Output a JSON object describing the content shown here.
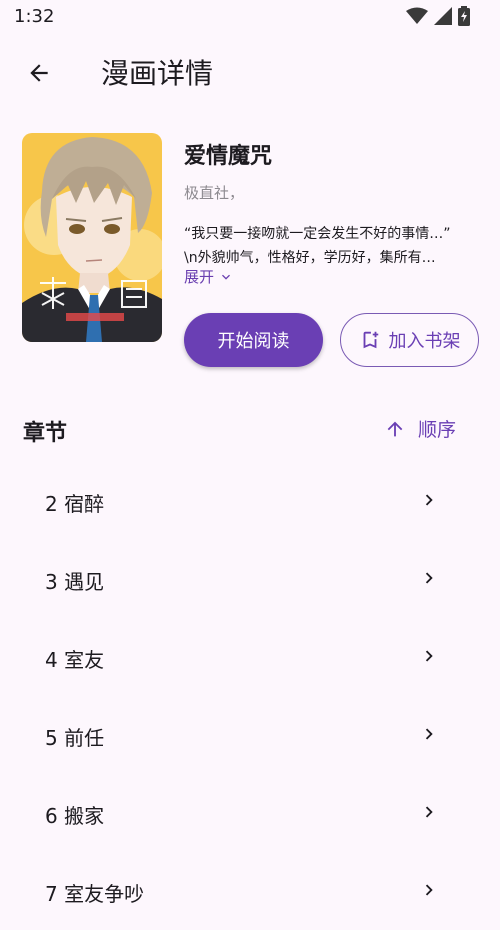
{
  "status_bar": {
    "time": "1:32"
  },
  "app_bar": {
    "title": "漫画详情"
  },
  "comic": {
    "title": "爱情魔咒",
    "author": "极直社，",
    "description_line1": "“我只要一接吻就一定会发生不好的事情…”",
    "description_line2": "\\n外貌帅气，性格好，学历好，集所有…",
    "expand_label": "展开"
  },
  "actions": {
    "read_label": "开始阅读",
    "shelf_label": "加入书架"
  },
  "chapters": {
    "section_title": "章节",
    "sort_label": "顺序",
    "items": [
      {
        "label": "2 宿醉"
      },
      {
        "label": "3 遇见"
      },
      {
        "label": "4 室友"
      },
      {
        "label": "5 前任"
      },
      {
        "label": "6 搬家"
      },
      {
        "label": "7 室友争吵"
      }
    ]
  },
  "colors": {
    "accent": "#6a3fb4",
    "background": "#fdf7fd",
    "text": "#1d1b20",
    "muted": "#8d8a90"
  }
}
